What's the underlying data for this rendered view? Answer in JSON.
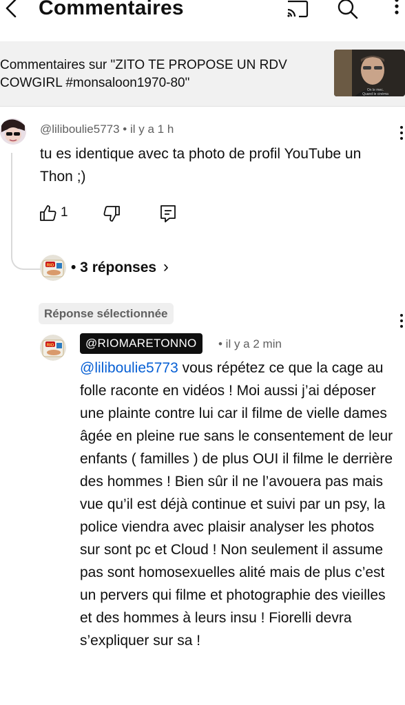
{
  "header": {
    "title": "Commentaires",
    "icons": [
      "back-icon",
      "cast-icon",
      "search-icon",
      "more-icon"
    ]
  },
  "context": {
    "text": "Commentaires sur \"ZITO TE PROPOSE UN RDV COWGIRL #monsaloon1970-80\"",
    "thumbnail_caption": "On le mec. Quand le cinéma etait..."
  },
  "comment": {
    "author": "@liliboulie5773",
    "time": "• il y a 1 h",
    "text": "tu es identique avec ta photo de profil YouTube un Thon ;)",
    "like_count": "1",
    "replies_label": "• 3 réponses",
    "replies_chevron": "›"
  },
  "selected_reply": {
    "chip_label": "Réponse sélectionnée",
    "author": "@RIOMARETONNO",
    "time": "• il y a 2 min",
    "mention": "@liliboulie5773",
    "text": " vous répétez ce que la cage au folle raconte en vidéos ! Moi aussi j’ai déposer une plainte contre lui car il filme de vielle dames âgée en pleine rue sans le consentement de leur enfants ( familles ) de plus OUI il filme le derrière des hommes ! Bien sûr il ne l’avouera pas mais vue qu’il est déjà continue et suivi par un psy, la police viendra avec plaisir analyser les photos sur sont pc et Cloud ! Non seulement il assume pas sont homosexuelles alité mais de plus c’est un pervers qui filme et photographie des vieilles et des hommes à leurs insu ! Fiorelli devra s’expliquer sur sa !",
    "avatar_logo": "RIO"
  }
}
